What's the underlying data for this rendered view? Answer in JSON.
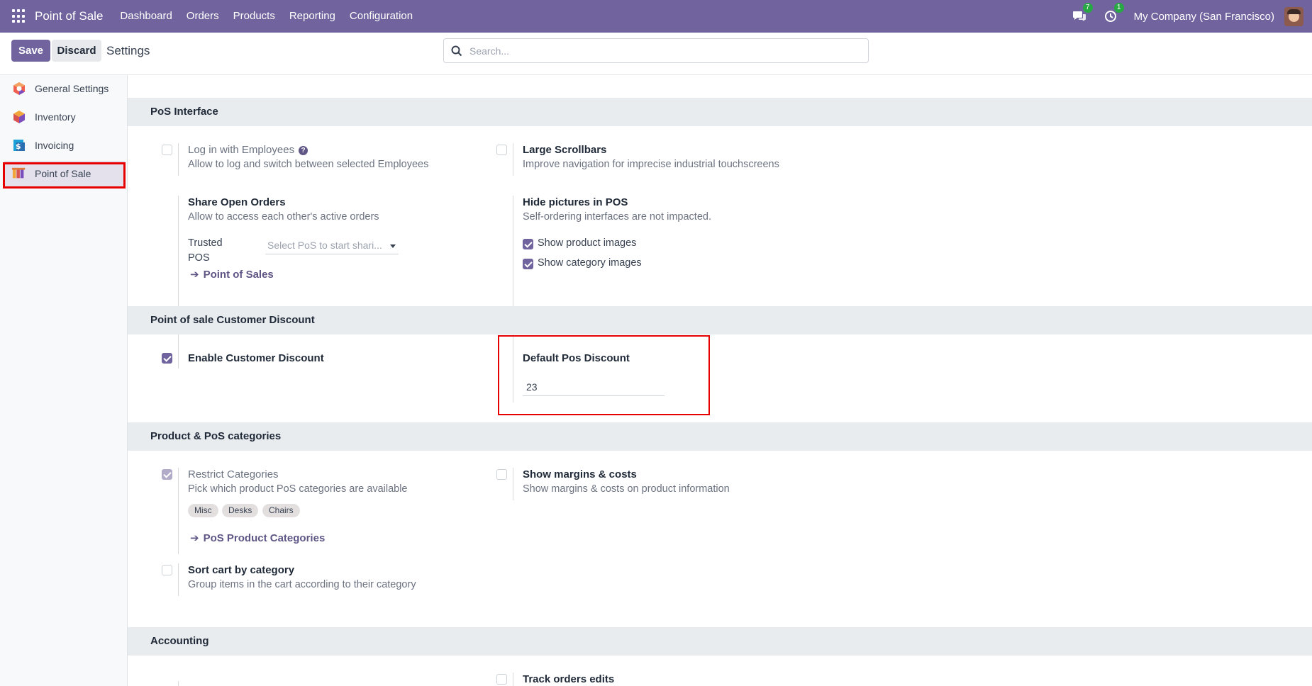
{
  "navbar": {
    "brand": "Point of Sale",
    "menu": [
      "Dashboard",
      "Orders",
      "Products",
      "Reporting",
      "Configuration"
    ],
    "messages_count": "7",
    "activities_count": "1",
    "company": "My Company (San Francisco)"
  },
  "control": {
    "save_label": "Save",
    "discard_label": "Discard",
    "breadcrumb": "Settings",
    "search_placeholder": "Search..."
  },
  "sidebar": {
    "items": [
      {
        "label": "General Settings",
        "icon": "general-settings-icon"
      },
      {
        "label": "Inventory",
        "icon": "inventory-icon"
      },
      {
        "label": "Invoicing",
        "icon": "invoicing-icon"
      },
      {
        "label": "Point of Sale",
        "icon": "point-of-sale-icon",
        "active": true
      }
    ]
  },
  "sections": {
    "pos_interface": {
      "title": "PoS Interface",
      "login_employees": {
        "title": "Log in with Employees",
        "desc": "Allow to log and switch between selected Employees",
        "checked": false
      },
      "large_scrollbars": {
        "title": "Large Scrollbars",
        "desc": "Improve navigation for imprecise industrial touchscreens",
        "checked": false
      },
      "share_orders": {
        "title": "Share Open Orders",
        "desc": "Allow to access each other's active orders",
        "trusted_label_1": "Trusted",
        "trusted_label_2": "POS",
        "trusted_placeholder": "Select PoS to start shari...",
        "link": "Point of Sales"
      },
      "hide_pictures": {
        "title": "Hide pictures in POS",
        "desc": "Self-ordering interfaces are not impacted.",
        "show_product_images": "Show product images",
        "show_category_images": "Show category images"
      }
    },
    "customer_discount": {
      "title": "Point of sale Customer Discount",
      "enable": {
        "title": "Enable Customer Discount",
        "checked": true
      },
      "default": {
        "title": "Default Pos Discount",
        "value": "23"
      }
    },
    "categories": {
      "title": "Product & PoS categories",
      "restrict": {
        "title": "Restrict Categories",
        "desc": "Pick which product PoS categories are available",
        "tags": [
          "Misc",
          "Desks",
          "Chairs"
        ],
        "link": "PoS Product Categories"
      },
      "margins": {
        "title": "Show margins & costs",
        "desc": "Show margins & costs on product information"
      },
      "sort_cart": {
        "title": "Sort cart by category",
        "desc": "Group items in the cart according to their category"
      }
    },
    "accounting": {
      "title": "Accounting",
      "track_edits": {
        "title": "Track orders edits"
      }
    }
  }
}
